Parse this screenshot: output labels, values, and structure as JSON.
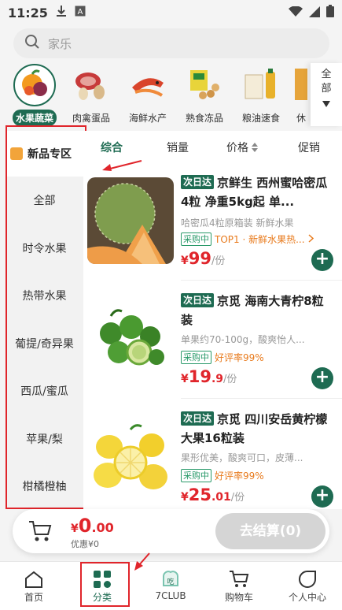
{
  "status_bar": {
    "time": "11:25",
    "download_icon": "download-icon",
    "app_icon": "a-icon"
  },
  "search": {
    "placeholder": "家乐"
  },
  "categories": [
    {
      "label": "水果蔬菜",
      "icon": "fruit-icon",
      "active": true
    },
    {
      "label": "肉禽蛋品",
      "icon": "meat-icon"
    },
    {
      "label": "海鲜水产",
      "icon": "seafood-icon"
    },
    {
      "label": "熟食冻品",
      "icon": "frozen-food-icon"
    },
    {
      "label": "粮油速食",
      "icon": "grain-oil-icon"
    },
    {
      "label": "休",
      "icon": "snack-icon"
    }
  ],
  "all_categories": {
    "line1": "全",
    "line2": "部"
  },
  "sidebar": {
    "new_label": "新品专区",
    "items": [
      "全部",
      "时令水果",
      "热带水果",
      "葡提/奇异果",
      "西瓜/蜜瓜",
      "苹果/梨",
      "柑橘橙柚"
    ]
  },
  "sort_tabs": [
    "综合",
    "销量",
    "价格",
    "促销"
  ],
  "products": [
    {
      "badge": "次日达",
      "title": "京鲜生 西州蜜哈密瓜 4粒 净重5kg起 单...",
      "desc": "哈密瓜4粒原箱装 新鲜水果",
      "buy_tag": "采购中",
      "highlight": "TOP1 · 新鲜水果热...",
      "price_int": "99",
      "price_dec": "",
      "unit": "/份"
    },
    {
      "badge": "次日达",
      "title": "京觅 海南大青柠8粒装",
      "desc": "单果约70-100g，酸爽怡人...",
      "buy_tag": "采购中",
      "highlight": "好评率99%",
      "price_int": "19",
      "price_dec": ".9",
      "unit": "/份"
    },
    {
      "badge": "次日达",
      "title": "京觅 四川安岳黄柠檬大果16粒装",
      "desc": "果形优美，酸爽可口，皮薄...",
      "buy_tag": "采购中",
      "highlight": "好评率99%",
      "price_int": "25",
      "price_dec": ".01",
      "unit": "/份"
    }
  ],
  "cart": {
    "currency": "¥",
    "amount_int": "0",
    "amount_dec": ".00",
    "discount": "优惠¥0",
    "checkout": "去结算(0)"
  },
  "tabbar": [
    {
      "label": "首页",
      "icon": "home-icon"
    },
    {
      "label": "分类",
      "icon": "category-icon",
      "active": true
    },
    {
      "label": "7CLUB",
      "icon": "club-icon"
    },
    {
      "label": "购物车",
      "icon": "cart-icon"
    },
    {
      "label": "个人中心",
      "icon": "profile-icon"
    }
  ],
  "colors": {
    "accent": "#1e6b52",
    "price": "#e0252b",
    "annotation": "#e0252b"
  }
}
